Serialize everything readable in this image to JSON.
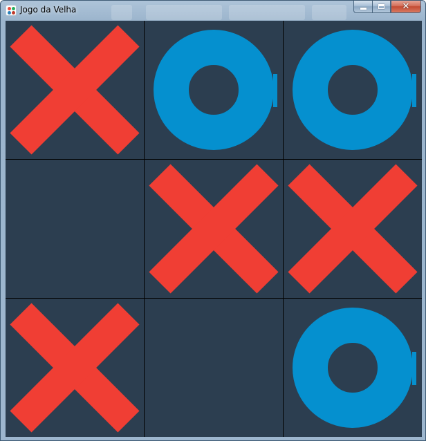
{
  "window": {
    "title": "Jogo da Velha",
    "controls": [
      "minimize",
      "maximize",
      "close"
    ]
  },
  "colors": {
    "background": "#2c3e50",
    "grid_line": "#000000",
    "x_color": "#f03e34",
    "o_color": "#0590cf"
  },
  "board": [
    [
      "X",
      "O",
      "O"
    ],
    [
      "",
      "X",
      "X"
    ],
    [
      "X",
      "",
      "O"
    ]
  ],
  "icons": {
    "app": "tic-tac-toe-icon",
    "x": "x-mark-icon",
    "o": "o-mark-icon"
  }
}
